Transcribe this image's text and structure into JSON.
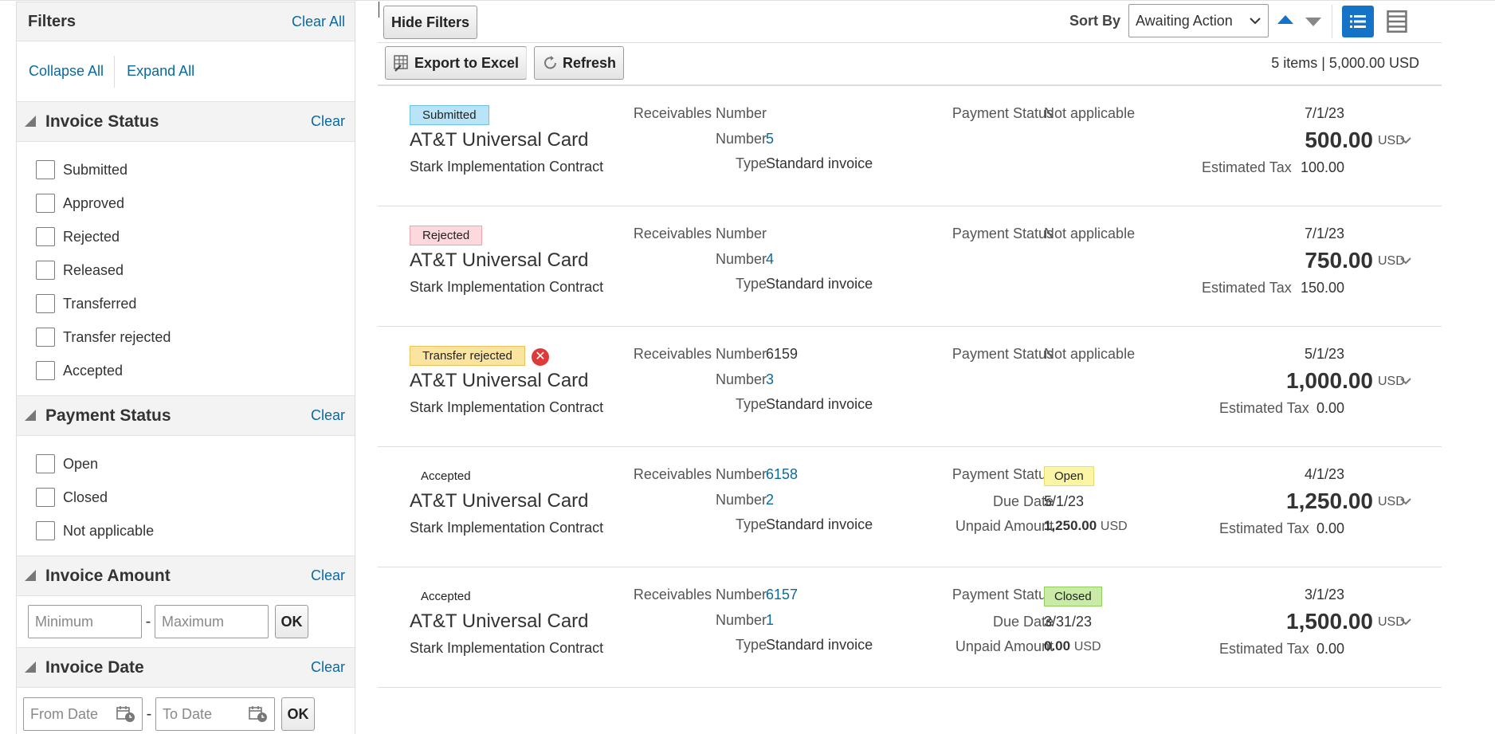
{
  "filters": {
    "title": "Filters",
    "clear_all": "Clear All",
    "collapse_all": "Collapse All",
    "expand_all": "Expand All",
    "invoice_status": {
      "title": "Invoice Status",
      "clear": "Clear",
      "options": [
        "Submitted",
        "Approved",
        "Rejected",
        "Released",
        "Transferred",
        "Transfer rejected",
        "Accepted"
      ]
    },
    "payment_status": {
      "title": "Payment Status",
      "clear": "Clear",
      "options": [
        "Open",
        "Closed",
        "Not applicable"
      ]
    },
    "invoice_amount": {
      "title": "Invoice Amount",
      "clear": "Clear",
      "min_placeholder": "Minimum",
      "max_placeholder": "Maximum",
      "ok": "OK"
    },
    "invoice_date": {
      "title": "Invoice Date",
      "clear": "Clear",
      "from_placeholder": "From Date",
      "to_placeholder": "To Date",
      "ok": "OK"
    }
  },
  "toolbar": {
    "hide_filters": "Hide Filters",
    "export": "Export to Excel",
    "refresh": "Refresh",
    "sort_by_label": "Sort By",
    "sort_by_value": "Awaiting Action",
    "summary": "5 items | 5,000.00 USD"
  },
  "labels": {
    "receivables_number": "Receivables Number",
    "number": "Number",
    "type": "Type",
    "payment_status": "Payment Status",
    "due_date": "Due Date",
    "unpaid_amount": "Unpaid Amount",
    "estimated_tax": "Estimated Tax",
    "currency": "USD"
  },
  "invoices": [
    {
      "status": "Submitted",
      "status_color": "#b9e4f7",
      "status_border": "#6ec1e4",
      "supplier": "AT&T Universal Card",
      "contract": "Stark Implementation Contract",
      "receivables_number": "",
      "number": "5",
      "type": "Standard invoice",
      "payment_status": "Not applicable",
      "date": "7/1/23",
      "amount": "500.00",
      "estimated_tax": "100.00"
    },
    {
      "status": "Rejected",
      "status_color": "#fbd9dc",
      "status_border": "#f0a3aa",
      "supplier": "AT&T Universal Card",
      "contract": "Stark Implementation Contract",
      "receivables_number": "",
      "number": "4",
      "type": "Standard invoice",
      "payment_status": "Not applicable",
      "date": "7/1/23",
      "amount": "750.00",
      "estimated_tax": "150.00"
    },
    {
      "status": "Transfer rejected",
      "status_color": "#fbe3a0",
      "status_border": "#e9c25a",
      "supplier": "AT&T Universal Card",
      "contract": "Stark Implementation Contract",
      "receivables_number": "6159",
      "number": "3",
      "type": "Standard invoice",
      "payment_status": "Not applicable",
      "date": "5/1/23",
      "amount": "1,000.00",
      "estimated_tax": "0.00"
    },
    {
      "status": "Accepted",
      "supplier": "AT&T Universal Card",
      "contract": "Stark Implementation Contract",
      "receivables_number": "6158",
      "number": "2",
      "type": "Standard invoice",
      "payment_status": "Open",
      "payment_color": "#fdf5a6",
      "payment_border": "#e8dc6a",
      "due_date": "5/1/23",
      "unpaid_amount": "1,250.00",
      "date": "4/1/23",
      "amount": "1,250.00",
      "estimated_tax": "0.00"
    },
    {
      "status": "Accepted",
      "supplier": "AT&T Universal Card",
      "contract": "Stark Implementation Contract",
      "receivables_number": "6157",
      "number": "1",
      "type": "Standard invoice",
      "payment_status": "Closed",
      "payment_color": "#c9eba6",
      "payment_border": "#8fce5c",
      "due_date": "3/31/23",
      "unpaid_amount": "0.00",
      "date": "3/1/23",
      "amount": "1,500.00",
      "estimated_tax": "0.00"
    }
  ]
}
